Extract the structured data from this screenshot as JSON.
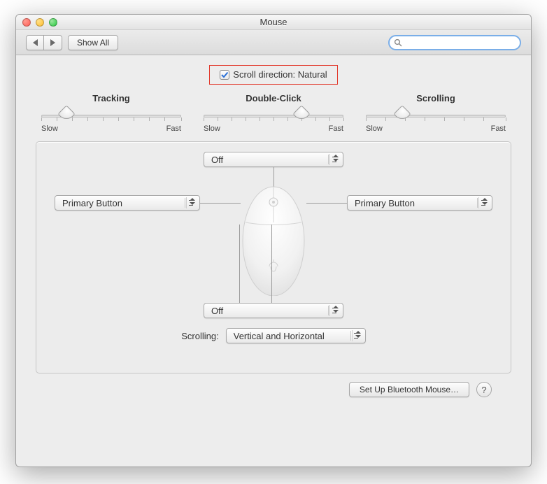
{
  "title": "Mouse",
  "toolbar": {
    "show_all": "Show All"
  },
  "search": {
    "placeholder": ""
  },
  "scroll_direction": {
    "label": "Scroll direction: Natural",
    "checked": true
  },
  "sliders": {
    "tracking": {
      "label": "Tracking",
      "slow": "Slow",
      "fast": "Fast",
      "value_pct": 18
    },
    "doubleclick": {
      "label": "Double-Click",
      "slow": "Slow",
      "fast": "Fast",
      "value_pct": 70
    },
    "scrolling": {
      "label": "Scrolling",
      "slow": "Slow",
      "fast": "Fast",
      "value_pct": 26
    }
  },
  "buttons": {
    "wheel": "Off",
    "left": "Primary Button",
    "right": "Primary Button",
    "side": "Off"
  },
  "scrolling_dropdown": {
    "label": "Scrolling:",
    "value": "Vertical and Horizontal"
  },
  "footer": {
    "setup_bt": "Set Up Bluetooth Mouse…",
    "help": "?"
  }
}
